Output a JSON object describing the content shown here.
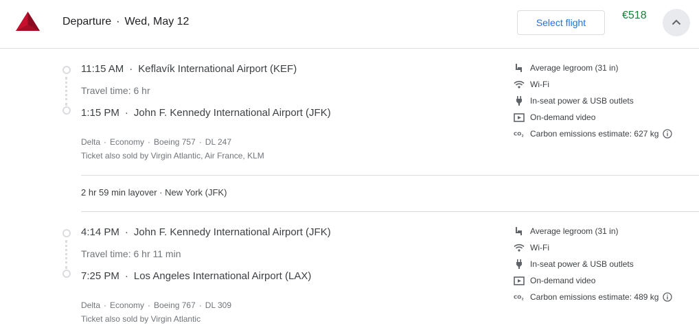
{
  "header": {
    "title": "Departure",
    "date": "Wed, May 12",
    "select_label": "Select flight",
    "price": "€518",
    "logo_icon": "delta-logo-icon",
    "collapse_icon": "chevron-up-icon"
  },
  "colors": {
    "accent": "#1a73e8",
    "price": "#188038",
    "brand": "#c8102e"
  },
  "segments": [
    {
      "depart_time": "11:15 AM",
      "depart_airport": "Keflavík International Airport (KEF)",
      "travel_time": "Travel time: 6 hr",
      "arrive_time": "1:15 PM",
      "arrive_airport": "John F. Kennedy International Airport (JFK)",
      "airline": "Delta",
      "cabin": "Economy",
      "aircraft": "Boeing 757",
      "flight_number": "DL 247",
      "also_sold": "Ticket also sold by Virgin Atlantic, Air France, KLM",
      "amenities": {
        "legroom": "Average legroom (31 in)",
        "wifi": "Wi-Fi",
        "power": "In-seat power & USB outlets",
        "video": "On-demand video",
        "emissions": "Carbon emissions estimate: 627 kg"
      }
    },
    {
      "depart_time": "4:14 PM",
      "depart_airport": "John F. Kennedy International Airport (JFK)",
      "travel_time": "Travel time: 6 hr 11 min",
      "arrive_time": "7:25 PM",
      "arrive_airport": "Los Angeles International Airport (LAX)",
      "airline": "Delta",
      "cabin": "Economy",
      "aircraft": "Boeing 767",
      "flight_number": "DL 309",
      "also_sold": "Ticket also sold by Virgin Atlantic",
      "amenities": {
        "legroom": "Average legroom (31 in)",
        "wifi": "Wi-Fi",
        "power": "In-seat power & USB outlets",
        "video": "On-demand video",
        "emissions": "Carbon emissions estimate: 489 kg"
      }
    }
  ],
  "layover": "2 hr 59 min layover · New York (JFK)"
}
